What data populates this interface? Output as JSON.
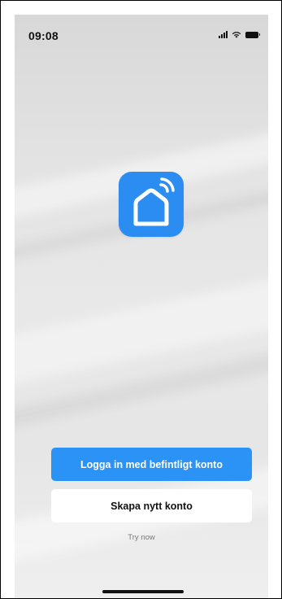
{
  "status_bar": {
    "time": "09:08",
    "icons": [
      "cellular-signal-icon",
      "wifi-icon",
      "battery-icon"
    ]
  },
  "app_icon": {
    "icon": "smart-home-wifi-icon",
    "background_color": "#2b8cf2"
  },
  "actions": {
    "login_label": "Logga in med befintligt konto",
    "create_label": "Skapa nytt konto",
    "try_now_label": "Try now"
  },
  "colors": {
    "primary_button": "#2b93f5",
    "secondary_button": "#ffffff",
    "link_text": "#7a7a7a"
  }
}
